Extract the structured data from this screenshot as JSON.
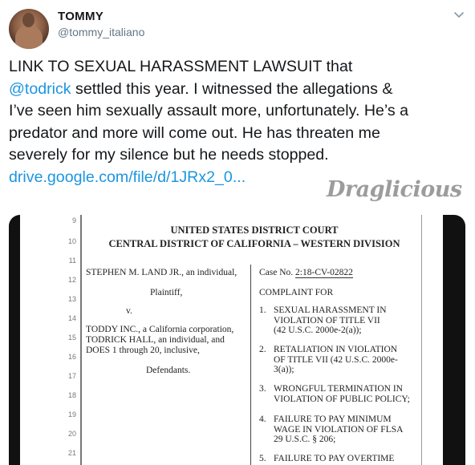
{
  "user": {
    "display_name": "TOMMY",
    "handle": "@tommy_italiano"
  },
  "icons": {
    "menu": "chevron-down-icon",
    "avatar": "profile-photo"
  },
  "colors": {
    "link": "#1b95e0",
    "text": "#14171a",
    "secondary": "#657786"
  },
  "tweet": {
    "line1": "LINK TO SEXUAL HARASSMENT LAWSUIT that",
    "mention": "@todrick",
    "line2_rest": " settled this year. I witnessed the allegations &",
    "line3": "I’ve seen him sexually assault more, unfortunately. He’s a",
    "line4": "predator and more will come out.  He has threaten me",
    "line5": "severely for my silence but he needs stopped.",
    "link": "drive.google.com/file/d/1JRx2_0..."
  },
  "watermark": "Draglicious",
  "document": {
    "court_title": "UNITED STATES DISTRICT COURT",
    "court_district": "CENTRAL DISTRICT OF CALIFORNIA – WESTERN DIVISION",
    "line_numbers": [
      "9",
      "10",
      "11",
      "12",
      "13",
      "14",
      "15",
      "16",
      "17",
      "18",
      "19",
      "20",
      "21"
    ],
    "plaintiff_name": "STEPHEN M. LAND JR., an individual,",
    "plaintiff_label": "Plaintiff,",
    "versus": "v.",
    "defendants_1": "TODDY INC., a California corporation,",
    "defendants_2": "TODRICK HALL, an individual, and",
    "defendants_3": "DOES 1 through 20, inclusive,",
    "defendants_label": "Defendants.",
    "case_no_label": "Case No.",
    "case_no": "2:18-CV-02822",
    "complaint_for": "COMPLAINT FOR",
    "claims": [
      {
        "n": "1.",
        "lines": [
          "SEXUAL HARASSMENT IN",
          "VIOLATION OF TITLE VII",
          "(42 U.S.C. 2000e-2(a));"
        ]
      },
      {
        "n": "2.",
        "lines": [
          "RETALIATION IN VIOLATION",
          "OF TITLE VII (42 U.S.C. 2000e-",
          "3(a));"
        ]
      },
      {
        "n": "3.",
        "lines": [
          "WRONGFUL TERMINATION IN",
          "VIOLATION OF PUBLIC POLICY;"
        ]
      },
      {
        "n": "4.",
        "lines": [
          "FAILURE TO PAY MINIMUM",
          "WAGE IN VIOLATION OF FLSA",
          "29 U.S.C. § 206;"
        ]
      },
      {
        "n": "5.",
        "lines": [
          "FAILURE TO PAY OVERTIME"
        ]
      }
    ]
  }
}
